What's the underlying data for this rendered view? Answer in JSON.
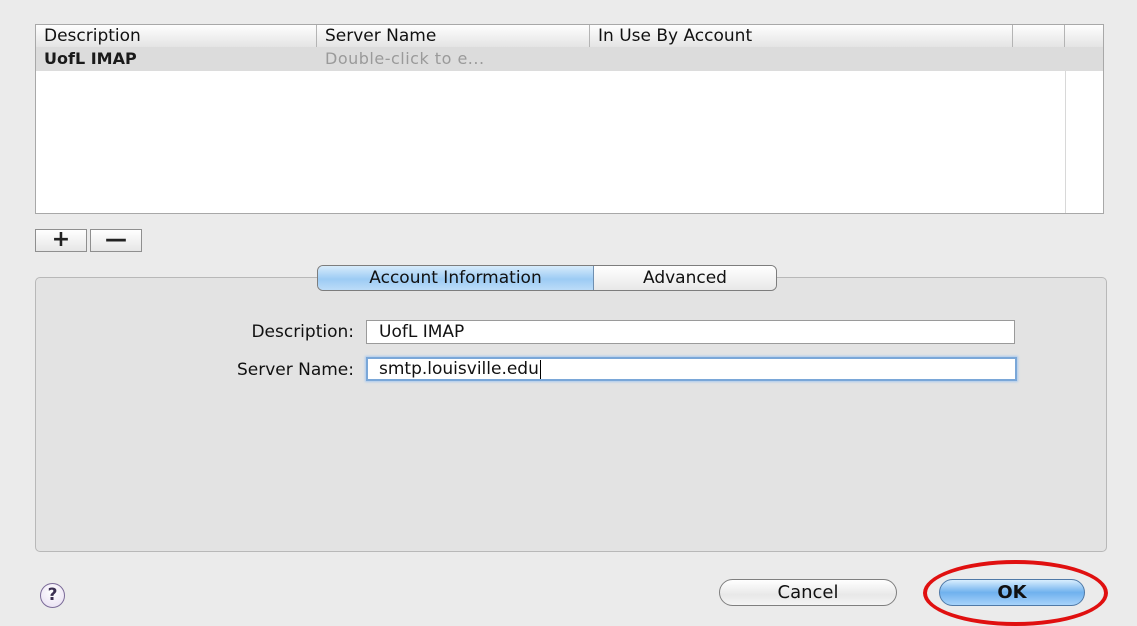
{
  "table": {
    "columns": [
      "Description",
      "Server Name",
      "In Use By Account"
    ],
    "rows": [
      {
        "description": "UofL IMAP",
        "server_name": "Double-click to e...",
        "in_use_by": ""
      }
    ]
  },
  "controls": {
    "add_label": "+",
    "remove_label": "—"
  },
  "tabs": [
    {
      "label": "Account Information",
      "selected": true
    },
    {
      "label": "Advanced",
      "selected": false
    }
  ],
  "form": {
    "description_label": "Description:",
    "description_value": "UofL IMAP",
    "server_name_label": "Server Name:",
    "server_name_value": "smtp.louisville.edu"
  },
  "buttons": {
    "help": "?",
    "cancel": "Cancel",
    "ok": "OK"
  },
  "colors": {
    "annotation": "#e01010",
    "selection": "#9ccbf4"
  }
}
